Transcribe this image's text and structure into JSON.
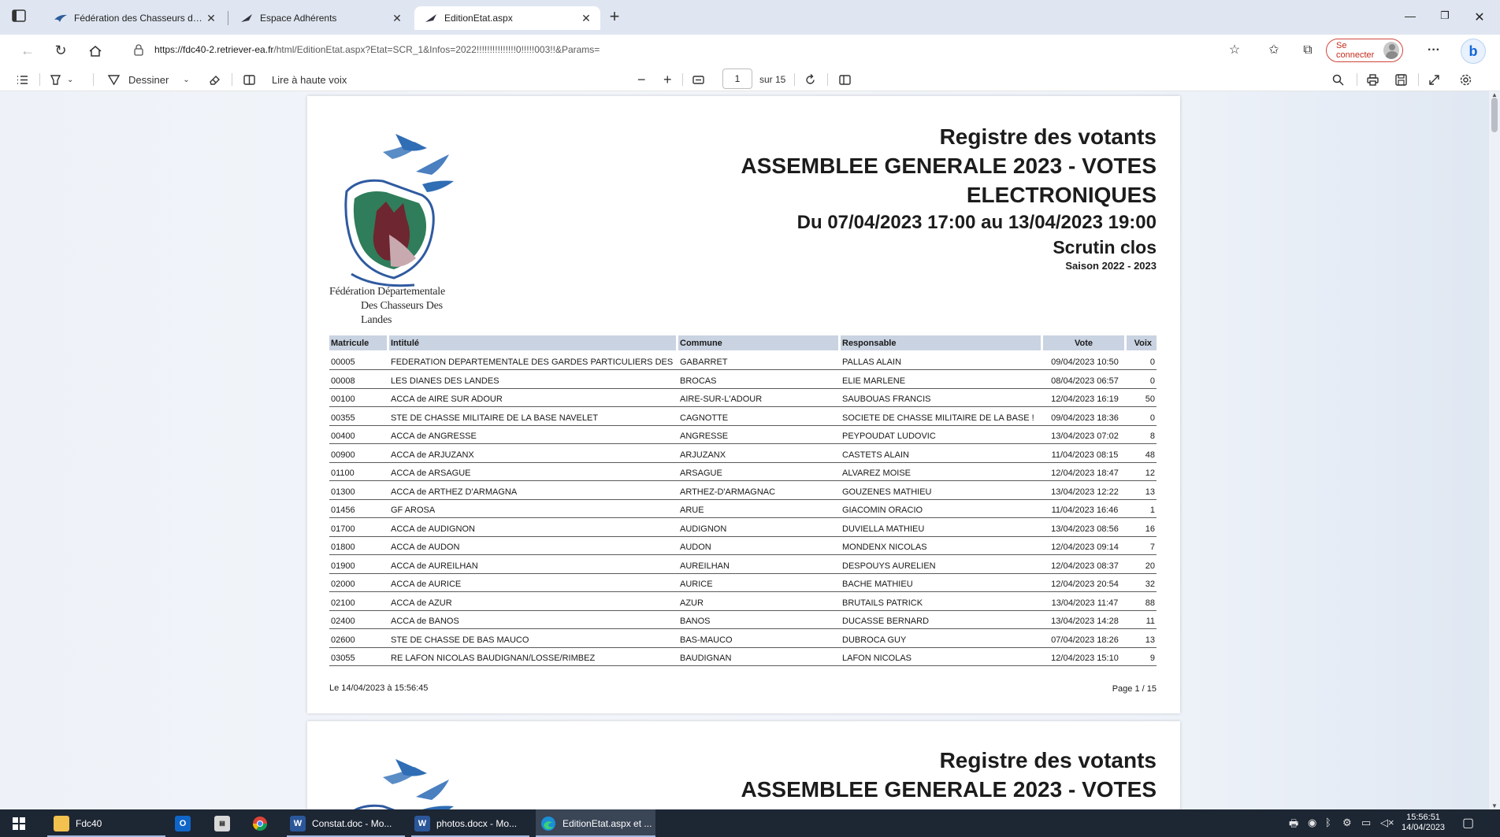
{
  "browser": {
    "tabs": [
      {
        "title": "Fédération des Chasseurs des La",
        "active": false
      },
      {
        "title": "Espace Adhérents",
        "active": false
      },
      {
        "title": "EditionEtat.aspx",
        "active": true
      }
    ],
    "url_host": "https://fdc40-2.retriever-ea.fr",
    "url_path": "/html/EditionEtat.aspx?Etat=SCR_1&Infos=2022!!!!!!!!!!!!!!!0!!!!!003!!&Params=",
    "signin_label": "Se connecter",
    "more_label": "···"
  },
  "pdf_toolbar": {
    "draw_label": "Dessiner",
    "read_aloud_label": "Lire à haute voix",
    "page_value": "1",
    "page_total": "sur 15"
  },
  "report": {
    "title1": "Registre des votants",
    "title2": "ASSEMBLEE GENERALE 2023 - VOTES",
    "title3": "ELECTRONIQUES",
    "period": "Du 07/04/2023 17:00 au 13/04/2023 19:00",
    "status": "Scrutin clos",
    "season": "Saison 2022 - 2023",
    "logo_line1": "Fédération Départementale",
    "logo_line2": "Des Chasseurs Des Landes",
    "columns": [
      "Matricule",
      "Intitulé",
      "Commune",
      "Responsable",
      "Vote",
      "Voix"
    ],
    "rows": [
      [
        "00005",
        "FEDERATION DEPARTEMENTALE DES GARDES PARTICULIERS DES",
        "GABARRET",
        "PALLAS ALAIN",
        "09/04/2023 10:50",
        "0"
      ],
      [
        "00008",
        "LES DIANES DES LANDES",
        "BROCAS",
        "ELIE MARLENE",
        "08/04/2023 06:57",
        "0"
      ],
      [
        "00100",
        "ACCA de AIRE SUR ADOUR",
        "AIRE-SUR-L'ADOUR",
        "SAUBOUAS FRANCIS",
        "12/04/2023 16:19",
        "50"
      ],
      [
        "00355",
        "STE DE CHASSE MILITAIRE DE LA BASE NAVELET",
        "CAGNOTTE",
        "SOCIETE DE CHASSE MILITAIRE DE LA BASE !",
        "09/04/2023 18:36",
        "0"
      ],
      [
        "00400",
        "ACCA de ANGRESSE",
        "ANGRESSE",
        "PEYPOUDAT LUDOVIC",
        "13/04/2023 07:02",
        "8"
      ],
      [
        "00900",
        "ACCA de ARJUZANX",
        "ARJUZANX",
        "CASTETS ALAIN",
        "11/04/2023 08:15",
        "48"
      ],
      [
        "01100",
        "ACCA de ARSAGUE",
        "ARSAGUE",
        "ALVAREZ MOISE",
        "12/04/2023 18:47",
        "12"
      ],
      [
        "01300",
        "ACCA de ARTHEZ D'ARMAGNA",
        "ARTHEZ-D'ARMAGNAC",
        "GOUZENES MATHIEU",
        "13/04/2023 12:22",
        "13"
      ],
      [
        "01456",
        "GF AROSA",
        "ARUE",
        "GIACOMIN ORACIO",
        "11/04/2023 16:46",
        "1"
      ],
      [
        "01700",
        "ACCA de AUDIGNON",
        "AUDIGNON",
        "DUVIELLA MATHIEU",
        "13/04/2023 08:56",
        "16"
      ],
      [
        "01800",
        "ACCA de AUDON",
        "AUDON",
        "MONDENX NICOLAS",
        "12/04/2023 09:14",
        "7"
      ],
      [
        "01900",
        "ACCA de AUREILHAN",
        "AUREILHAN",
        "DESPOUYS AURELIEN",
        "12/04/2023 08:37",
        "20"
      ],
      [
        "02000",
        "ACCA de AURICE",
        "AURICE",
        "BACHE MATHIEU",
        "12/04/2023 20:54",
        "32"
      ],
      [
        "02100",
        "ACCA de AZUR",
        "AZUR",
        "BRUTAILS PATRICK",
        "13/04/2023 11:47",
        "88"
      ],
      [
        "02400",
        "ACCA de BANOS",
        "BANOS",
        "DUCASSE BERNARD",
        "13/04/2023 14:28",
        "11"
      ],
      [
        "02600",
        "STE DE CHASSE DE BAS MAUCO",
        "BAS-MAUCO",
        "DUBROCA GUY",
        "07/04/2023 18:26",
        "13"
      ],
      [
        "03055",
        "RE LAFON NICOLAS BAUDIGNAN/LOSSE/RIMBEZ",
        "BAUDIGNAN",
        "LAFON NICOLAS",
        "12/04/2023 15:10",
        "9"
      ]
    ],
    "footer_date": "Le  14/04/2023  à  15:56:45",
    "footer_page": "Page 1 / 15"
  },
  "taskbar": {
    "items": [
      {
        "label": "Fdc40",
        "icon": "folder-icon"
      },
      {
        "label": "Constat.doc - Mo...",
        "icon": "word-icon"
      },
      {
        "label": "photos.docx - Mo...",
        "icon": "word-icon"
      },
      {
        "label": "EditionEtat.aspx et ...",
        "icon": "edge-icon"
      }
    ],
    "time": "15:56:51",
    "date": "14/04/2023"
  },
  "colors": {
    "tab_strip": "#dfe6f1",
    "table_header": "#c9d3e1",
    "taskbar": "#1d2633",
    "signin_border": "#d0453b"
  }
}
